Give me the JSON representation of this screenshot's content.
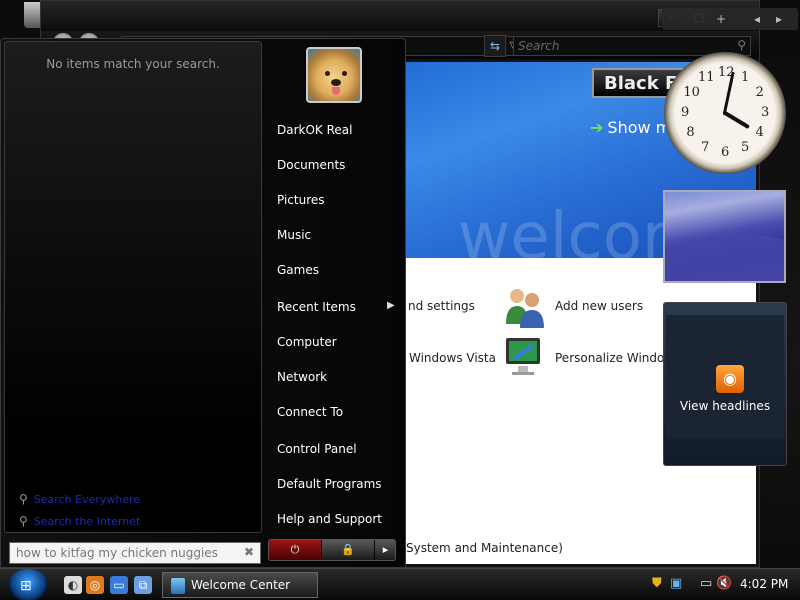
{
  "window": {
    "search_placeholder": "Search",
    "banner": {
      "theme_button": "Black Ed",
      "show_more": "Show m",
      "welcome_watermark": "welcor"
    },
    "tasks": [
      {
        "label": "nd settings"
      },
      {
        "label": "Add new users",
        "icon": "users-icon"
      },
      {
        "label": "Windows Vista"
      },
      {
        "label": "Personalize Windows",
        "icon": "personalize-icon"
      },
      {
        "label": "System and Maintenance)"
      }
    ]
  },
  "start_menu": {
    "no_results": "No items match your search.",
    "links": [
      "Search Everywhere",
      "Search the Internet"
    ],
    "search_value": "how to kitfag my chicken nuggies",
    "right_items": [
      {
        "label": "DarkOK Real"
      },
      {
        "label": "Documents"
      },
      {
        "label": "Pictures"
      },
      {
        "label": "Music"
      },
      {
        "label": "Games"
      },
      {
        "label": "Recent Items",
        "has_submenu": true
      },
      {
        "label": "Computer"
      },
      {
        "label": "Network"
      },
      {
        "label": "Connect To"
      },
      {
        "label": "Control Panel"
      },
      {
        "label": "Default Programs"
      },
      {
        "label": "Help and Support"
      }
    ],
    "power_icon": "power-icon",
    "lock_icon": "lock-icon"
  },
  "sidebar": {
    "clock_numbers": [
      "12",
      "1",
      "2",
      "3",
      "4",
      "5",
      "6",
      "7",
      "8",
      "9",
      "10",
      "11"
    ],
    "clock_time": {
      "hour": 4,
      "minute": 2
    },
    "feeds_label": "View headlines"
  },
  "taskbar": {
    "task_label": "Welcome Center",
    "time": "4:02 PM",
    "quick_launch": [
      "show-desktop-icon",
      "firefox-icon",
      "window-icon",
      "switch-windows-icon"
    ],
    "tray_icons": [
      "security-shield-icon",
      "network-icon",
      "volume-muted-icon"
    ]
  },
  "colors": {
    "accent_blue": "#2a6fd6",
    "power_red": "#9c1414"
  }
}
